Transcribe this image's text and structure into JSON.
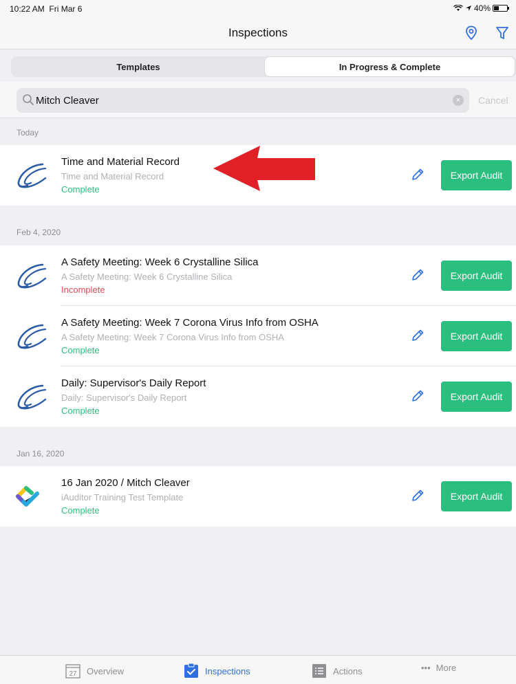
{
  "status_bar": {
    "time": "10:22 AM",
    "date": "Fri Mar 6",
    "battery": "40%"
  },
  "header": {
    "title": "Inspections"
  },
  "segments": [
    {
      "label": "Templates",
      "active": false
    },
    {
      "label": "In Progress & Complete",
      "active": true
    }
  ],
  "search": {
    "value": "Mitch Cleaver",
    "cancel_label": "Cancel"
  },
  "sections": [
    {
      "header": "Today",
      "items": [
        {
          "title": "Time and Material Record",
          "subtitle": "Time and Material Record",
          "status": "Complete",
          "action": "Export Audit"
        }
      ]
    },
    {
      "header": "Feb 4, 2020",
      "items": [
        {
          "title": "A Safety Meeting: Week 6 Crystalline Silica",
          "subtitle": "A Safety Meeting: Week 6 Crystalline Silica",
          "status": "Incomplete",
          "action": "Export Audit"
        },
        {
          "title": "A Safety Meeting: Week 7  Corona Virus Info from OSHA",
          "subtitle": "A Safety Meeting: Week 7  Corona Virus Info from OSHA",
          "status": "Complete",
          "action": "Export Audit"
        },
        {
          "title": "Daily: Supervisor's Daily Report",
          "subtitle": "Daily: Supervisor's Daily Report",
          "status": "Complete",
          "action": "Export Audit"
        }
      ]
    },
    {
      "header": "Jan 16, 2020",
      "items": [
        {
          "title": "16 Jan 2020 / Mitch Cleaver",
          "subtitle": "iAuditor Training Test Template",
          "status": "Complete",
          "action": "Export Audit"
        }
      ]
    }
  ],
  "tabbar": {
    "items": [
      {
        "label": "Overview",
        "icon": "calendar-icon",
        "icon_text": "27"
      },
      {
        "label": "Inspections",
        "icon": "clipboard-check-icon",
        "active": true
      },
      {
        "label": "Actions",
        "icon": "list-icon"
      },
      {
        "label": "More",
        "icon": "more-dots-icon",
        "icon_text": "•••"
      }
    ]
  },
  "colors": {
    "accent": "#2f6fe0",
    "success": "#2bbf7f",
    "danger": "#e44c57",
    "annotation_arrow": "#e11f26"
  }
}
